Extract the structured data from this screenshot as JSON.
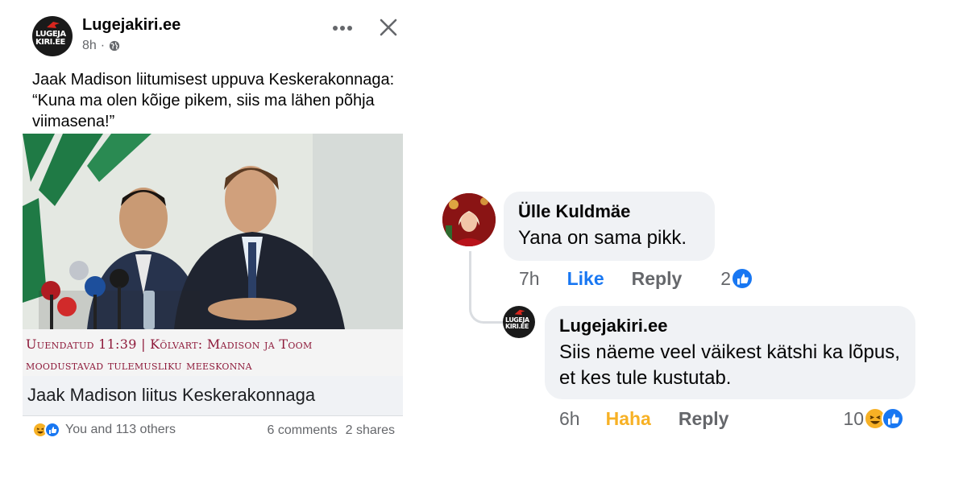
{
  "post": {
    "page_name": "Lugejakiri.ee",
    "avatar_text_1": "LUGEJA",
    "avatar_text_2": "KIRI.EE",
    "time": "8h",
    "dot": "·",
    "text": "Jaak Madison liitumisest uppuva Keskerakonnaga: “Kuna ma olen kõige pikem, siis ma lähen põhja viimasena!”",
    "caption_line_1": "Uuendatud 11:39 | Kõlvart: Madison ja Toom",
    "caption_line_2": "moodustavad tulemusliku meeskonna",
    "link_title": "Jaak Madison liitus Keskerakonnaga",
    "reactions_text": "You and 113 others",
    "comments_count": "6 comments",
    "shares_count": "2 shares",
    "icons": {
      "more": "more-dots-icon",
      "close": "close-icon",
      "globe": "globe-icon"
    }
  },
  "comments": [
    {
      "author": "Ülle Kuldmäe",
      "text": "Yana on sama pikk.",
      "time": "7h",
      "action_1": "Like",
      "action_2": "Reply",
      "reaction_count": "2"
    },
    {
      "author": "Lugejakiri.ee",
      "avatar_text_1": "LUGEJA",
      "avatar_text_2": "KIRI.EE",
      "text": "Siis näeme veel väikest kätshi ka lõpus, et kes tule kustutab.",
      "time": "6h",
      "action_1": "Haha",
      "action_2": "Reply",
      "reaction_count": "10"
    }
  ],
  "colors": {
    "like_blue": "#1877f2",
    "haha_yellow": "#f7b125",
    "caption_red": "#8e1a3a",
    "bubble_gray": "#f0f2f5"
  }
}
